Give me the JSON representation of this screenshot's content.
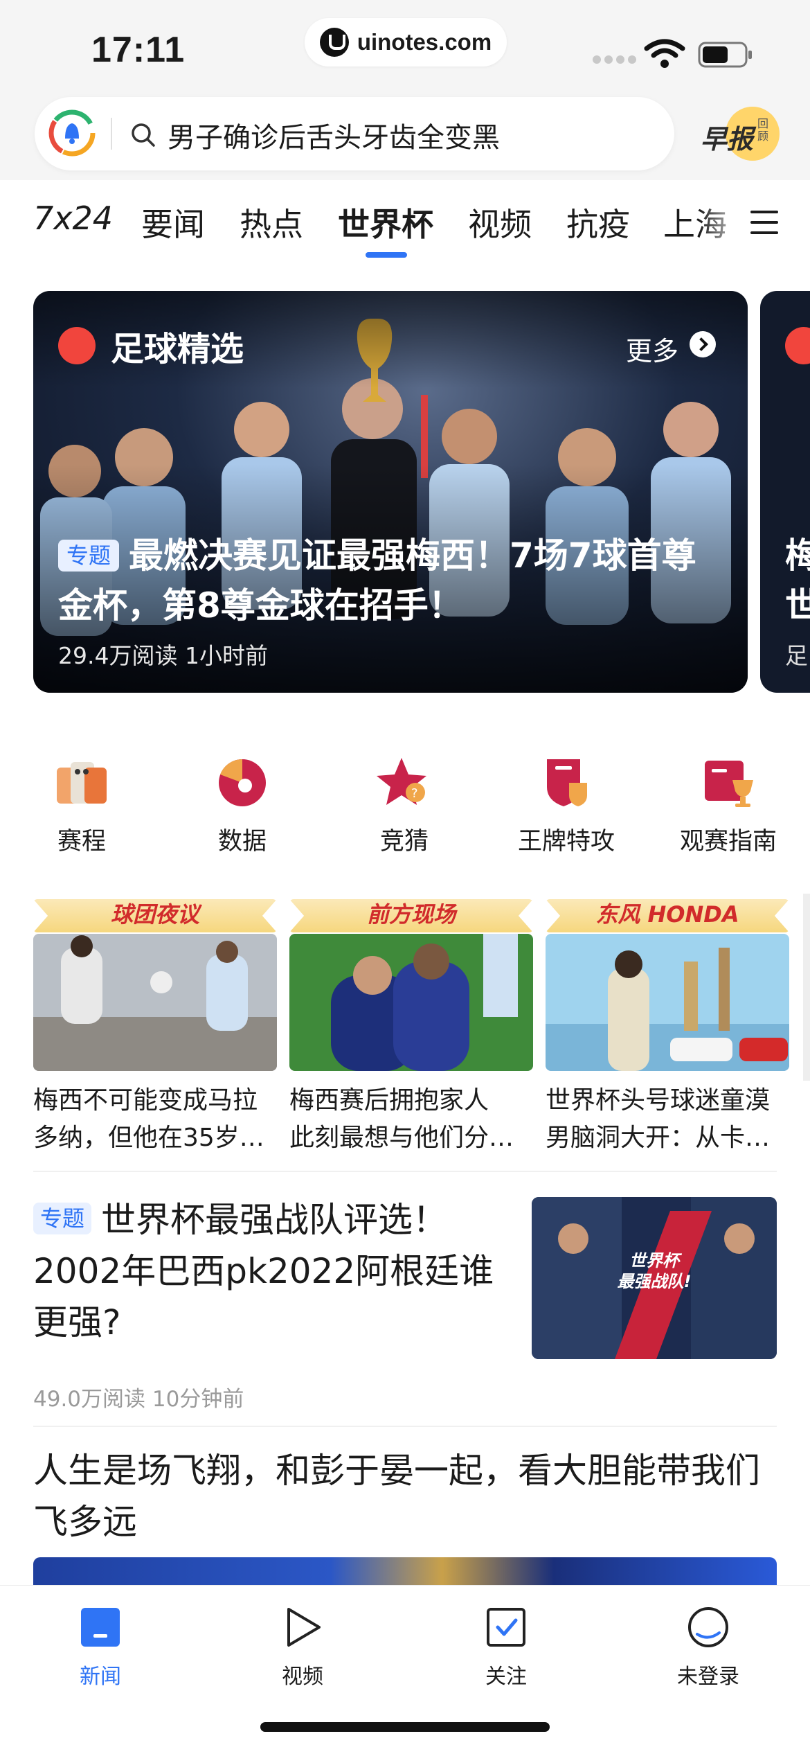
{
  "status_bar": {
    "time": "17:11",
    "url": "uinotes.com"
  },
  "search": {
    "query": "男子确诊后舌头牙齿全变黑",
    "morning_label": "早报",
    "morning_sub": "回顾"
  },
  "tabs": [
    {
      "label": "7x24"
    },
    {
      "label": "要闻"
    },
    {
      "label": "热点"
    },
    {
      "label": "世界杯",
      "active": true
    },
    {
      "label": "视频"
    },
    {
      "label": "抗疫"
    },
    {
      "label": "上海"
    }
  ],
  "hero": {
    "section_label": "足球精选",
    "more_label": "更多",
    "tag": "专题",
    "title": "最燃决赛见证最强梅西！7场7球首尊金杯，第8尊金球在招手！",
    "meta": "29.4万阅读  1小时前",
    "peek_title": "梅\n世",
    "peek_meta": "足"
  },
  "quick_entries": [
    {
      "label": "赛程",
      "icon": "schedule-icon"
    },
    {
      "label": "数据",
      "icon": "data-pie-icon"
    },
    {
      "label": "竞猜",
      "icon": "quiz-star-icon"
    },
    {
      "label": "王牌特攻",
      "icon": "shield-icon"
    },
    {
      "label": "观赛指南",
      "icon": "trophy-guide-icon"
    }
  ],
  "video_cards": [
    {
      "banner": "球团夜议",
      "title_line1": "梅西不可能变成马拉",
      "title_line2": "多纳，但他在35岁…"
    },
    {
      "banner": "前方现场",
      "title_line1": "梅西赛后拥抱家人",
      "title_line2": "此刻最想与他们分…"
    },
    {
      "banner": "东风 HONDA",
      "title_line1": "世界杯头号球迷童漠",
      "title_line2": "男脑洞大开：从卡…"
    }
  ],
  "article1": {
    "tag": "专题",
    "title": "世界杯最强战队评选！2002年巴西pk2022阿根廷谁更强?",
    "meta": "49.0万阅读  10分钟前",
    "thumb_text": "世界杯\n最强战队!"
  },
  "article2": {
    "title": "人生是场飞翔，和彭于晏一起，看大胆能带我们飞多远"
  },
  "bottom_nav": [
    {
      "label": "新闻",
      "active": true
    },
    {
      "label": "视频"
    },
    {
      "label": "关注"
    },
    {
      "label": "未登录"
    }
  ],
  "colors": {
    "accent": "#2f74f5",
    "fire": "#f1453d",
    "quick_red": "#c8234a"
  }
}
